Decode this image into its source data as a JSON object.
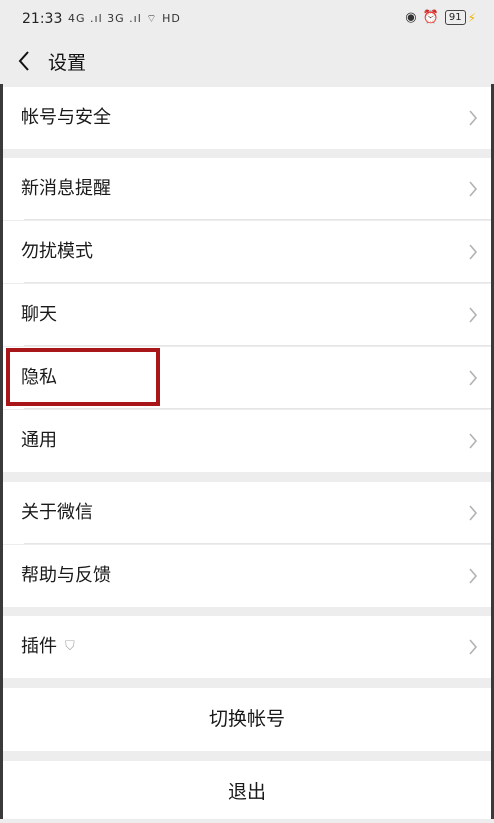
{
  "status_bar": {
    "time": "21:33",
    "signal": "4G .ıl 3G .ıl ",
    "hd_label": "HD",
    "battery": "91",
    "icons": [
      "lock-rotation-icon",
      "alarm-icon",
      "charging-icon"
    ]
  },
  "nav": {
    "title": "设置"
  },
  "rows": {
    "account_security": "帐号与安全",
    "new_message": "新消息提醒",
    "do_not_disturb": "勿扰模式",
    "chat": "聊天",
    "privacy": "隐私",
    "general": "通用",
    "about": "关于微信",
    "help_feedback": "帮助与反馈",
    "plugins": "插件"
  },
  "buttons": {
    "switch_account": "切换帐号",
    "logout": "退出"
  },
  "colors": {
    "background": "#ededed",
    "row_background": "#ffffff",
    "highlight_border": "#a8161a"
  }
}
